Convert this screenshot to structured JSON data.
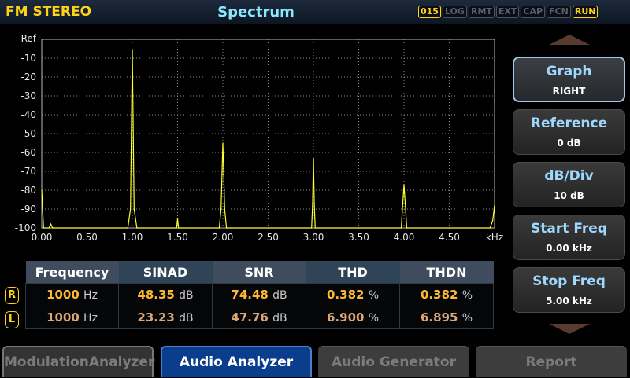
{
  "header": {
    "app_title": "FM STEREO",
    "screen_title": "Spectrum",
    "indicators": [
      {
        "label": "015",
        "active": true
      },
      {
        "label": "LOG",
        "active": false
      },
      {
        "label": "RMT",
        "active": false
      },
      {
        "label": "EXT",
        "active": false
      },
      {
        "label": "CAP",
        "active": false
      },
      {
        "label": "FCN",
        "active": false
      },
      {
        "label": "RUN",
        "active": true
      }
    ]
  },
  "chart_data": {
    "type": "line",
    "y_axis_labels": [
      "Ref",
      "-10",
      "-20",
      "-30",
      "-40",
      "-50",
      "-60",
      "-70",
      "-80",
      "-90",
      "-100"
    ],
    "x_ticks": [
      "0.00",
      "0.50",
      "1.00",
      "1.50",
      "2.00",
      "2.50",
      "3.00",
      "3.50",
      "4.00",
      "4.50"
    ],
    "x_unit": "kHz",
    "xlim": [
      0,
      5
    ],
    "ylim": [
      -100,
      0
    ],
    "grid": true,
    "series": [
      {
        "color": "#ffff33",
        "x": [
          0,
          0.02,
          0.08,
          0.1,
          0.12,
          0.95,
          0.98,
          1.0,
          1.02,
          1.05,
          1.49,
          1.5,
          1.51,
          1.96,
          1.98,
          2.0,
          2.02,
          2.04,
          2.98,
          2.99,
          3.0,
          3.01,
          3.02,
          3.97,
          3.98,
          4.0,
          4.02,
          4.03,
          4.95,
          4.98,
          5.0
        ],
        "values": [
          -80,
          -100,
          -100,
          -98,
          -100,
          -100,
          -90,
          -6,
          -90,
          -100,
          -100,
          -95,
          -100,
          -100,
          -90,
          -55,
          -90,
          -100,
          -100,
          -88,
          -63,
          -88,
          -100,
          -100,
          -92,
          -77,
          -92,
          -100,
          -100,
          -96,
          -88
        ]
      }
    ]
  },
  "measurements": {
    "headers": [
      "Frequency",
      "SINAD",
      "SNR",
      "THD",
      "THDN"
    ],
    "rows": [
      {
        "channel": "R",
        "frequency": "1000",
        "frequency_unit": "Hz",
        "sinad": "48.35",
        "sinad_unit": "dB",
        "snr": "74.48",
        "snr_unit": "dB",
        "thd": "0.382",
        "thd_unit": "%",
        "thdn": "0.382",
        "thdn_unit": "%"
      },
      {
        "channel": "L",
        "frequency": "1000",
        "frequency_unit": "Hz",
        "sinad": "23.23",
        "sinad_unit": "dB",
        "snr": "47.76",
        "snr_unit": "dB",
        "thd": "6.900",
        "thd_unit": "%",
        "thdn": "6.895",
        "thdn_unit": "%"
      }
    ]
  },
  "side_menu": [
    {
      "label": "Graph",
      "value": "RIGHT"
    },
    {
      "label": "Reference",
      "value": "0 dB"
    },
    {
      "label": "dB/Div",
      "value": "10 dB"
    },
    {
      "label": "Start Freq",
      "value": "0.00 kHz"
    },
    {
      "label": "Stop Freq",
      "value": "5.00 kHz"
    }
  ],
  "tabs": [
    {
      "label": "ModulationAnalyzer"
    },
    {
      "label": "Audio Analyzer"
    },
    {
      "label": "Audio Generator"
    },
    {
      "label": "Report"
    }
  ]
}
